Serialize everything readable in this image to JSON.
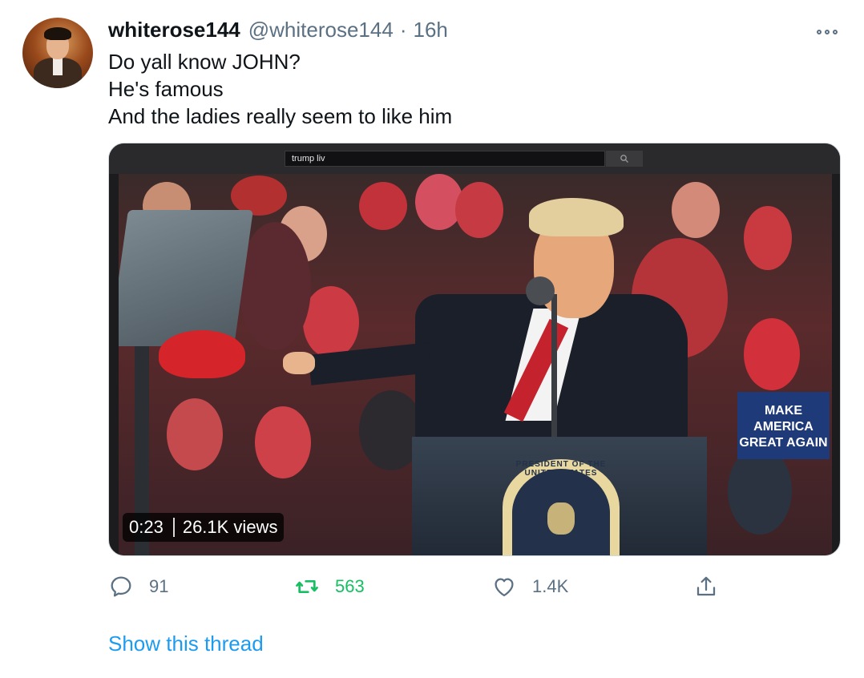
{
  "tweet": {
    "display_name": "whiterose144",
    "handle": "@whiterose144",
    "separator": "·",
    "time": "16h",
    "lines": [
      "Do yall know JOHN?",
      "He's famous",
      "And the ladies really seem to like him"
    ]
  },
  "media": {
    "browser_query": "trump liv",
    "browser_search_icon": "search-icon",
    "duration": "0:23",
    "views": "26.1K views",
    "seal_text": "PRESIDENT OF THE UNITED STATES",
    "sign_text": "MAKE AMERICA GREAT AGAIN"
  },
  "actions": {
    "reply_count": "91",
    "retweet_count": "563",
    "like_count": "1.4K",
    "reply_icon": "reply-icon",
    "retweet_icon": "retweet-icon",
    "like_icon": "heart-icon",
    "share_icon": "share-icon"
  },
  "thread_link": "Show this thread",
  "colors": {
    "retweet": "#17bf63",
    "link": "#1d9bf0",
    "secondary": "#5b7083",
    "primary": "#0f1419"
  }
}
